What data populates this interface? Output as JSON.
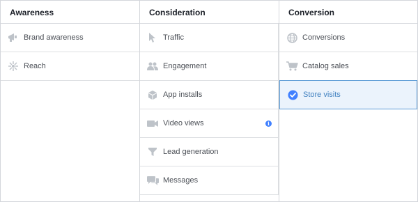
{
  "columns": {
    "awareness": {
      "header": "Awareness",
      "items": [
        {
          "label": "Brand awareness",
          "icon": "megaphone-icon"
        },
        {
          "label": "Reach",
          "icon": "reach-icon"
        }
      ]
    },
    "consideration": {
      "header": "Consideration",
      "items": [
        {
          "label": "Traffic",
          "icon": "cursor-icon"
        },
        {
          "label": "Engagement",
          "icon": "people-icon"
        },
        {
          "label": "App installs",
          "icon": "box-icon"
        },
        {
          "label": "Video views",
          "icon": "video-camera-icon",
          "info": "i"
        },
        {
          "label": "Lead generation",
          "icon": "funnel-icon"
        },
        {
          "label": "Messages",
          "icon": "chat-bubbles-icon"
        }
      ]
    },
    "conversion": {
      "header": "Conversion",
      "items": [
        {
          "label": "Conversions",
          "icon": "globe-icon"
        },
        {
          "label": "Catalog sales",
          "icon": "cart-icon"
        },
        {
          "label": "Store visits",
          "icon": "checkmark-circle-icon",
          "selected": true
        }
      ]
    }
  },
  "colors": {
    "icon_gray": "#bec3c9",
    "selected_blue": "#4080ff",
    "selected_bg": "#ebf3fc"
  }
}
